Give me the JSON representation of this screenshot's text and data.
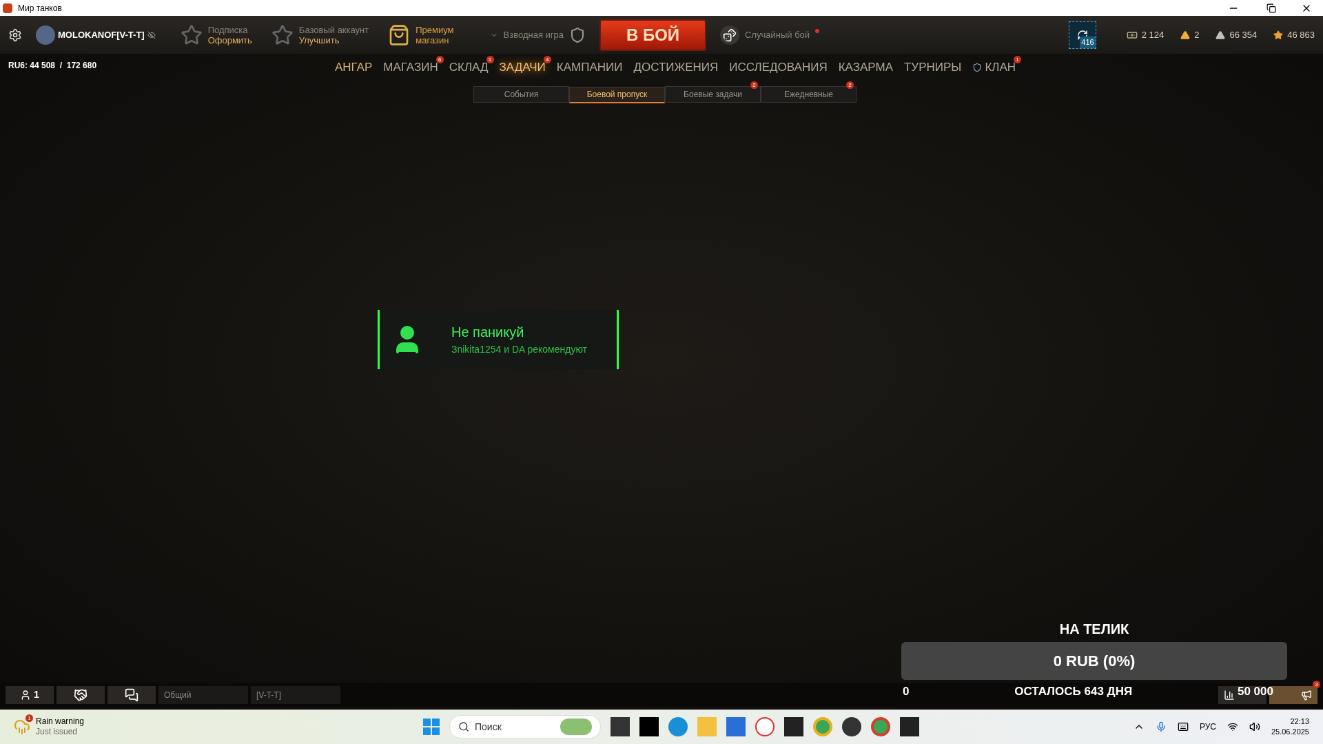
{
  "window": {
    "title": "Мир танков"
  },
  "header": {
    "player": "MOLOKANOF[V-T-T]",
    "subscription": {
      "label": "Подписка",
      "action": "Оформить"
    },
    "account": {
      "label": "Базовый аккаунт",
      "action": "Улучшить"
    },
    "premium_shop": {
      "line1": "Премиум",
      "line2": "магазин"
    },
    "platoon": "Взводная игра",
    "battle_button": "В БОЙ",
    "mode": "Случайный бой",
    "booster_count": "416",
    "currencies": [
      {
        "kind": "credits",
        "value": "2 124"
      },
      {
        "kind": "gold",
        "value": "2"
      },
      {
        "kind": "silver",
        "value": "66 354"
      },
      {
        "kind": "xp",
        "value": "46 863"
      }
    ]
  },
  "server": "RU6: 44 508  /  172 680",
  "nav": [
    {
      "label": "АНГАР",
      "selected": false
    },
    {
      "label": "МАГАЗИН",
      "badge": "6",
      "selected": false
    },
    {
      "label": "СКЛАД",
      "badge": "1",
      "selected": false
    },
    {
      "label": "ЗАДАЧИ",
      "badge": "4",
      "selected": true
    },
    {
      "label": "КАМПАНИИ",
      "selected": false
    },
    {
      "label": "ДОСТИЖЕНИЯ",
      "selected": false
    },
    {
      "label": "ИССЛЕДОВАНИЯ",
      "selected": false
    },
    {
      "label": "КАЗАРМА",
      "selected": false
    },
    {
      "label": "ТУРНИРЫ",
      "selected": false
    },
    {
      "label": "КЛАН",
      "badge": "1",
      "selected": false
    }
  ],
  "subtabs": [
    {
      "label": "События",
      "selected": false
    },
    {
      "label": "Боевой пропуск",
      "selected": true
    },
    {
      "label": "Боевые задачи",
      "badge": "2",
      "selected": false
    },
    {
      "label": "Ежедневные",
      "badge": "2",
      "selected": false
    }
  ],
  "notice": {
    "title": "Не паникуй",
    "subtitle": "Зnikita1254 и DA рекомендуют"
  },
  "donation": {
    "title": "НА ТЕЛИК",
    "amount": "0 RUB (0%)",
    "level": 0,
    "start": "0",
    "remaining": "ОСТАЛОСЬ 643 ДНЯ",
    "goal": "50 000"
  },
  "bottom_bar": {
    "platoon_count": "1",
    "chat_channels": [
      "Общий",
      "[V-T-T]"
    ],
    "notifications_badge": "3"
  },
  "taskbar": {
    "weather": {
      "title": "Rain warning",
      "subtitle": "Just issued",
      "badge": "1"
    },
    "search_placeholder": "Поиск",
    "language": "РУС",
    "time": "22:13",
    "date": "25.06.2025"
  }
}
